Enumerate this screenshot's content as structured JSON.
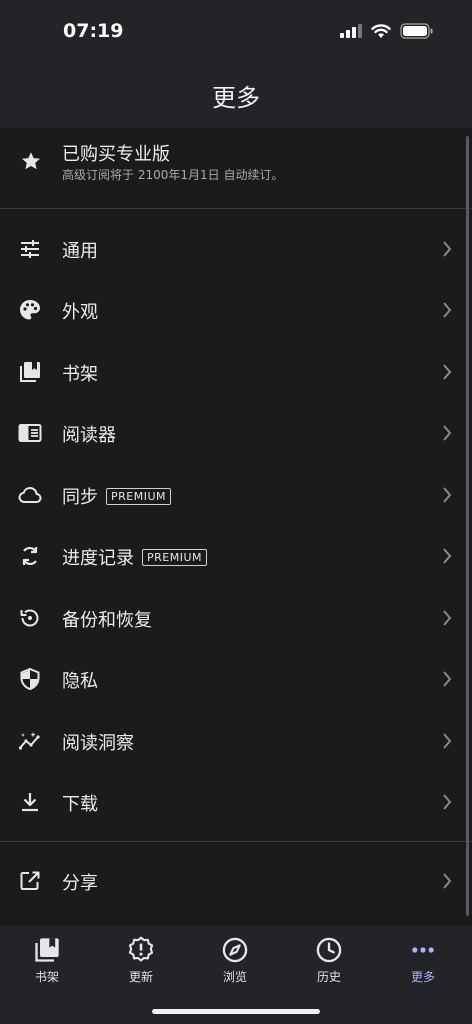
{
  "status_bar": {
    "time": "07:19"
  },
  "header": {
    "title": "更多"
  },
  "pro": {
    "title": "已购买专业版",
    "subtitle": "高级订阅将于 2100年1月1日 自动续订。",
    "icon": "star-icon"
  },
  "menu": [
    {
      "label": "通用",
      "icon": "sliders-icon"
    },
    {
      "label": "外观",
      "icon": "palette-icon"
    },
    {
      "label": "书架",
      "icon": "bookshelf-icon"
    },
    {
      "label": "阅读器",
      "icon": "reader-icon"
    },
    {
      "label": "同步",
      "icon": "cloud-icon",
      "badge": "PREMIUM"
    },
    {
      "label": "进度记录",
      "icon": "sync-icon",
      "badge": "PREMIUM"
    },
    {
      "label": "备份和恢复",
      "icon": "restore-icon"
    },
    {
      "label": "隐私",
      "icon": "shield-icon"
    },
    {
      "label": "阅读洞察",
      "icon": "insights-icon"
    },
    {
      "label": "下载",
      "icon": "download-icon"
    }
  ],
  "share": {
    "label": "分享",
    "icon": "share-icon"
  },
  "tabs": [
    {
      "label": "书架",
      "icon": "bookshelf-icon"
    },
    {
      "label": "更新",
      "icon": "alert-badge-icon"
    },
    {
      "label": "浏览",
      "icon": "compass-icon"
    },
    {
      "label": "历史",
      "icon": "clock-icon"
    },
    {
      "label": "更多",
      "icon": "more-icon",
      "active": true
    }
  ],
  "colors": {
    "background": "#1b1b1d",
    "bar": "#232427",
    "active_tab": "#aab3f5"
  }
}
